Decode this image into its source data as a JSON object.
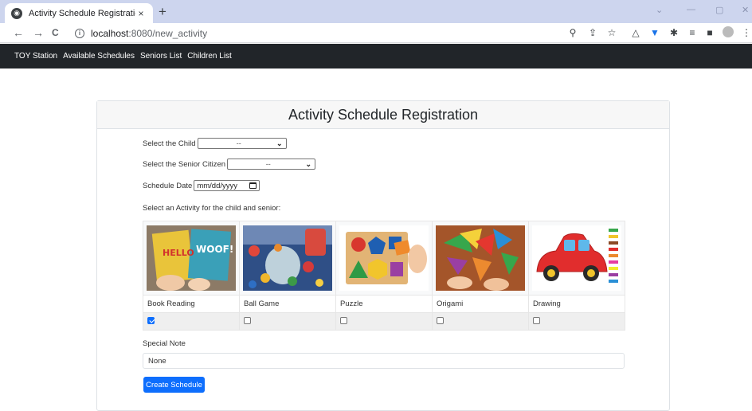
{
  "browser": {
    "tab_title": "Activity Schedule Registration",
    "tab_close": "×",
    "new_tab": "+",
    "url_host": "localhost",
    "url_path": ":8080/new_activity",
    "back": "←",
    "forward": "→",
    "reload": "C",
    "win_minimize_glyph": "—",
    "win_restore_glyph": "▢",
    "win_close_glyph": "✕",
    "win_down_glyph": "⌄"
  },
  "nav": {
    "items": [
      "TOY Station",
      "Available Schedules",
      "Seniors List",
      "Children List"
    ]
  },
  "form": {
    "title": "Activity Schedule Registration",
    "child_label": "Select the Child",
    "child_value": "--",
    "senior_label": "Select the Senior Citizen",
    "senior_value": "--",
    "date_label": "Schedule Date",
    "date_placeholder": "mm/dd/yyyy",
    "activity_prompt": "Select an Activity for the child and senior:",
    "activities": [
      {
        "label": "Book Reading",
        "checked": true
      },
      {
        "label": "Ball Game",
        "checked": false
      },
      {
        "label": "Puzzle",
        "checked": false
      },
      {
        "label": "Origami",
        "checked": false
      },
      {
        "label": "Drawing",
        "checked": false
      }
    ],
    "note_label": "Special Note",
    "note_value": "None",
    "submit_label": "Create Schedule"
  },
  "colors": {
    "primary": "#0d6efd",
    "navbar": "#212529",
    "tabstrip": "#cdd5ee"
  }
}
